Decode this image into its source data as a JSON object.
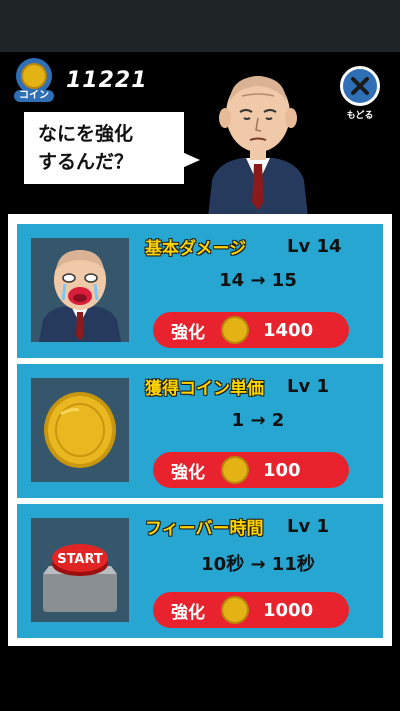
{
  "header": {
    "coin_label": "コイン",
    "coin_amount": "11221",
    "back_label": "もどる"
  },
  "speech": {
    "line1": "なにを強化",
    "line2": "するんだ？"
  },
  "upgrades": [
    {
      "title": "基本ダメージ",
      "level": "Lv 14",
      "change": "14 → 15",
      "buy_label": "強化",
      "cost": "1400",
      "icon": "crying-man-icon"
    },
    {
      "title": "獲得コイン単価",
      "level": "Lv 1",
      "change": "1 → 2",
      "buy_label": "強化",
      "cost": "100",
      "icon": "gold-coin-icon"
    },
    {
      "title": "フィーバー時間",
      "level": "Lv 1",
      "change": "10秒 → 11秒",
      "buy_label": "強化",
      "cost": "1000",
      "icon": "start-button-icon",
      "icon_text": "START"
    }
  ],
  "colors": {
    "card": "#26a6d1",
    "buy_button": "#e8232d",
    "title_yellow": "#ffd400",
    "coin_gold": "#e3b315",
    "accent_blue": "#2f6fb5"
  }
}
